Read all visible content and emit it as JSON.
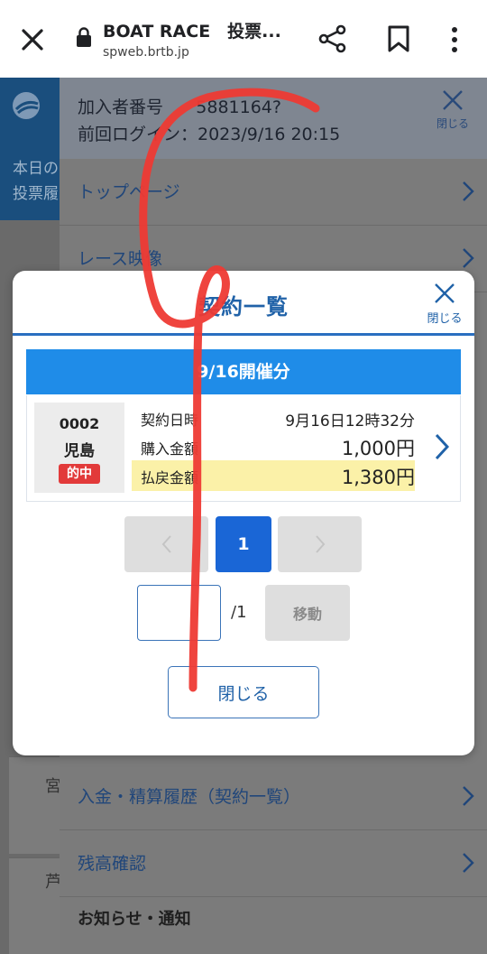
{
  "browser": {
    "title": "BOAT RACE　投票...",
    "url": "spweb.brtb.jp"
  },
  "background": {
    "left_panel": {
      "line1": "本日の",
      "line2": "投票履"
    },
    "fragments": [
      "宮",
      "芦"
    ]
  },
  "drawer": {
    "member_label": "加入者番号",
    "member_number": "5881164?",
    "last_login": "前回ログイン：2023/9/16 20:15",
    "close_label": "閉じる",
    "items": [
      {
        "label": "トップページ"
      },
      {
        "label": "レース映像"
      },
      {
        "label": "入金・精算履歴（契約一覧）"
      },
      {
        "label": "残高確認"
      }
    ],
    "notice_title": "お知らせ・通知"
  },
  "modal": {
    "title": "契約一覧",
    "close_label": "閉じる",
    "date_header": "9/16開催分",
    "contract": {
      "venue_number": "0002",
      "venue_name": "児島",
      "status_badge": "的中",
      "contract_datetime_label": "契約日時",
      "contract_datetime": "9月16日12時32分",
      "purchase_label": "購入金額",
      "purchase_amount": "1,000円",
      "payout_label": "払戻金額",
      "payout_amount": "1,380円"
    },
    "pagination": {
      "current_page": "1",
      "total": "/1",
      "input_value": "",
      "move_label": "移動"
    },
    "close_button_label": "閉じる"
  },
  "colors": {
    "accent_blue": "#1f8ce8",
    "title_blue": "#2062a8",
    "hit_red": "#e23a3a",
    "payout_highlight": "#fbf1a8",
    "annotation_red": "#ee3a34"
  }
}
